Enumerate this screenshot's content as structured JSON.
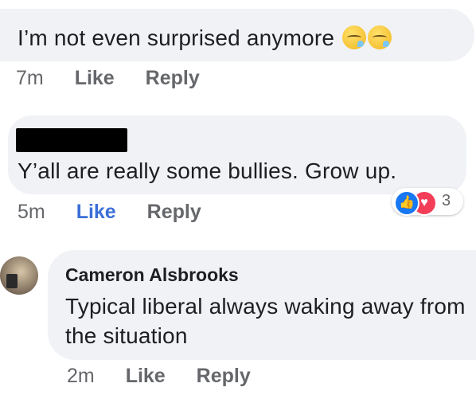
{
  "comments": [
    {
      "text": "I’m not even surprised anymore",
      "emojis": [
        "sleepy-face",
        "sleepy-face"
      ],
      "time": "7m",
      "like_label": "Like",
      "reply_label": "Reply"
    },
    {
      "author_redacted": true,
      "text": "Y’all are really some bullies. Grow up.",
      "time": "5m",
      "like_label": "Like",
      "reply_label": "Reply",
      "reactions": {
        "types": [
          "like",
          "love"
        ],
        "count": "3"
      },
      "like_color": "#3b6fd8"
    },
    {
      "author": "Cameron Alsbrooks",
      "text": "Typical liberal always waking away from the situation",
      "time": "2m",
      "like_label": "Like",
      "reply_label": "Reply"
    }
  ],
  "colors": {
    "bubble_bg": "#f0f2f5",
    "meta_text": "#65676b",
    "like_reaction": "#1877f2",
    "love_reaction": "#f33e58"
  }
}
